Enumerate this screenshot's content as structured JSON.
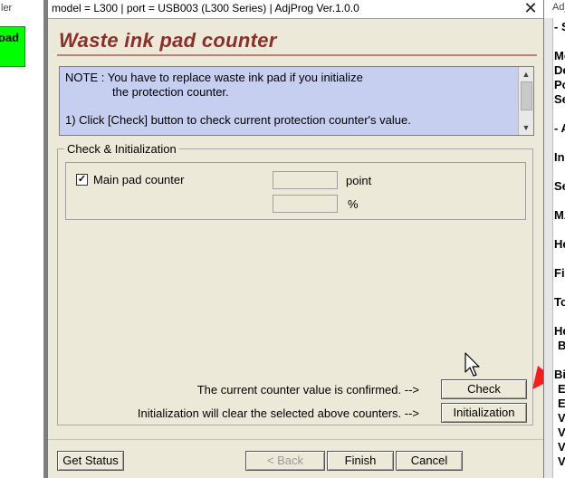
{
  "left_window": {
    "title": "ler",
    "green_button_label": "oad"
  },
  "dialog": {
    "title": "model = L300 | port = USB003 (L300 Series) | AdjProg Ver.1.0.0",
    "close_glyph": "✕",
    "page_title": "Waste ink pad counter",
    "note": {
      "line1": "NOTE : You have to replace waste ink pad if you initialize",
      "line2": "the protection counter.",
      "line3": "1) Click [Check] button to check current protection counter's value."
    },
    "group_label": "Check & Initialization",
    "counter": {
      "label": "Main pad counter",
      "checked": true,
      "check_glyph": "✓",
      "point_value": "",
      "percent_value": "",
      "point_unit": "point",
      "percent_unit": "%"
    },
    "check_text": "The current counter value is confirmed. -->",
    "init_text": "Initialization will clear the selected above counters. -->",
    "buttons": {
      "check": "Check",
      "initialization": "Initialization",
      "get_status": "Get Status",
      "back": "< Back",
      "finish": "Finish",
      "cancel": "Cancel"
    },
    "colors": {
      "title_color": "#8b2e2e",
      "note_bg": "#c6cfef",
      "arrow_color": "#ff1a1a"
    }
  },
  "right_window": {
    "title": "Adj",
    "lines": [
      "- S",
      "Mo",
      "De",
      "Po",
      "Se",
      "- A",
      "In",
      "Se",
      "MA",
      "He",
      "Fi",
      "To",
      "He",
      "B",
      "Bi",
      "E",
      "E",
      "V",
      "V",
      "V",
      "V"
    ]
  },
  "icons": {
    "close": "close-icon",
    "cursor": "mouse-cursor-icon",
    "arrow": "red-arrow-icon",
    "scroll_up": "▲",
    "scroll_down": "▼"
  }
}
